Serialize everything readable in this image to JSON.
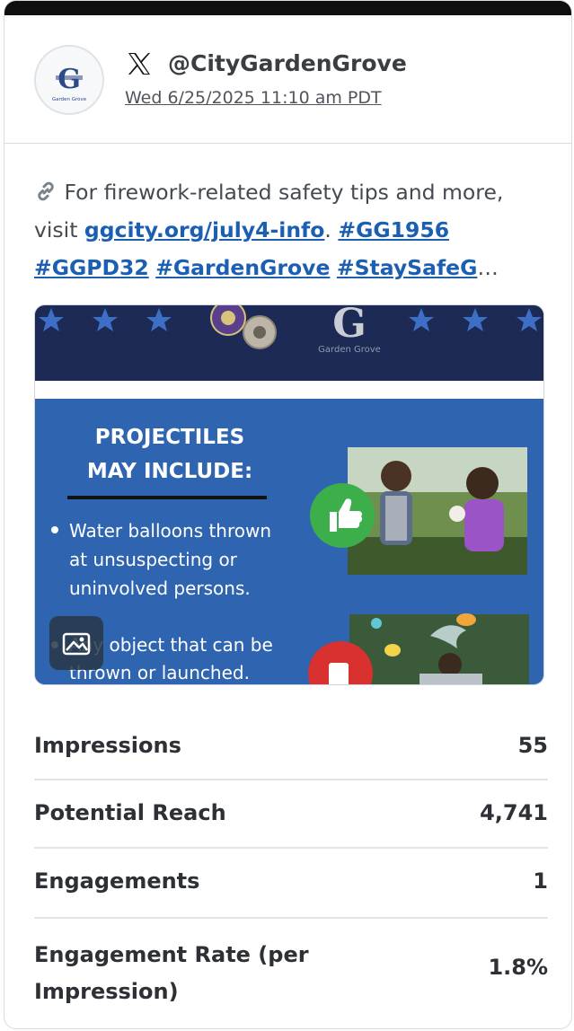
{
  "account": {
    "handle": "@CityGardenGrove",
    "timestamp": "Wed 6/25/2025 11:10 am PDT",
    "avatar_text": "Garden Grove"
  },
  "post": {
    "link_icon": "link-icon",
    "text_before": "For firework-related safety tips and more, visit ",
    "link": "ggcity.org/july4-info",
    "after_link": ".",
    "hashtags": [
      "#GG1956",
      "#GGPD32",
      "#GardenGrove",
      "#StaySafeG"
    ],
    "ellipsis": "…"
  },
  "media": {
    "logo_text": "Garden Grove",
    "heading_line1": "PROJECTILES",
    "heading_line2": "MAY INCLUDE:",
    "bullet1_line1": "Water balloons thrown",
    "bullet1_line2": "at unsuspecting or",
    "bullet1_line3": "uninvolved persons.",
    "bullet2_line1": "Any object that can be",
    "bullet2_line2": "thrown or launched.",
    "badge_icon": "image-icon"
  },
  "stats": [
    {
      "label": "Impressions",
      "value": "55"
    },
    {
      "label": "Potential Reach",
      "value": "4,741"
    },
    {
      "label": "Engagements",
      "value": "1"
    },
    {
      "label": "Engagement Rate (per Impression)",
      "value": "1.8%"
    }
  ],
  "colors": {
    "link": "#1b5fb3",
    "flyer_blue": "#2f65b0",
    "flyer_navy": "#1c2a55",
    "thumb_green": "#3cae4a",
    "thumb_red": "#d9312f"
  }
}
